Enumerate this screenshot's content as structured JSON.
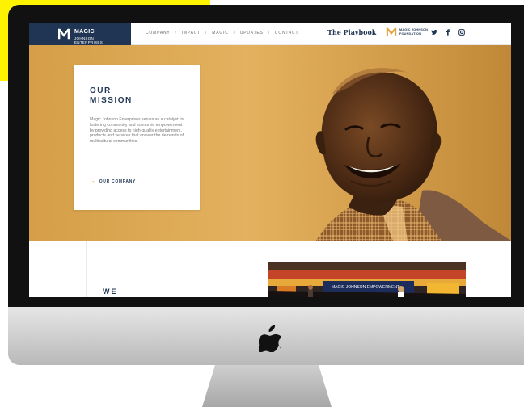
{
  "site": {
    "brand": {
      "line1": "MAGIC",
      "line2": "JOHNSON",
      "line3": "ENTERPRISES"
    },
    "nav": {
      "items": [
        "COMPANY",
        "IMPACT",
        "MAGIC",
        "UPDATES",
        "CONTACT"
      ],
      "separator": "/"
    },
    "partner_links": {
      "playbook": "The Playbook",
      "foundation_line1": "MAGIC JOHNSON",
      "foundation_line2": "FOUNDATION"
    },
    "social_icons": [
      "twitter-icon",
      "facebook-icon",
      "instagram-icon"
    ],
    "hero": {
      "heading_line1": "OUR",
      "heading_line2": "MISSION",
      "body": "Magic Johnson Enterprises serves as a catalyst for fostering community and economic empowerment by providing access to high-quality entertainment, products and services that answer the demands of multicultural communities.",
      "link_label": "OUR COMPANY"
    },
    "lower": {
      "section_label": "WE",
      "photo_caption": "MAGIC JOHNSON EMPOWERMENT"
    }
  },
  "colors": {
    "navy": "#1f3553",
    "gold": "#e0a441",
    "hero_bg": "#d8a350",
    "bezel": "#111111",
    "background_accent": "#fff200"
  }
}
